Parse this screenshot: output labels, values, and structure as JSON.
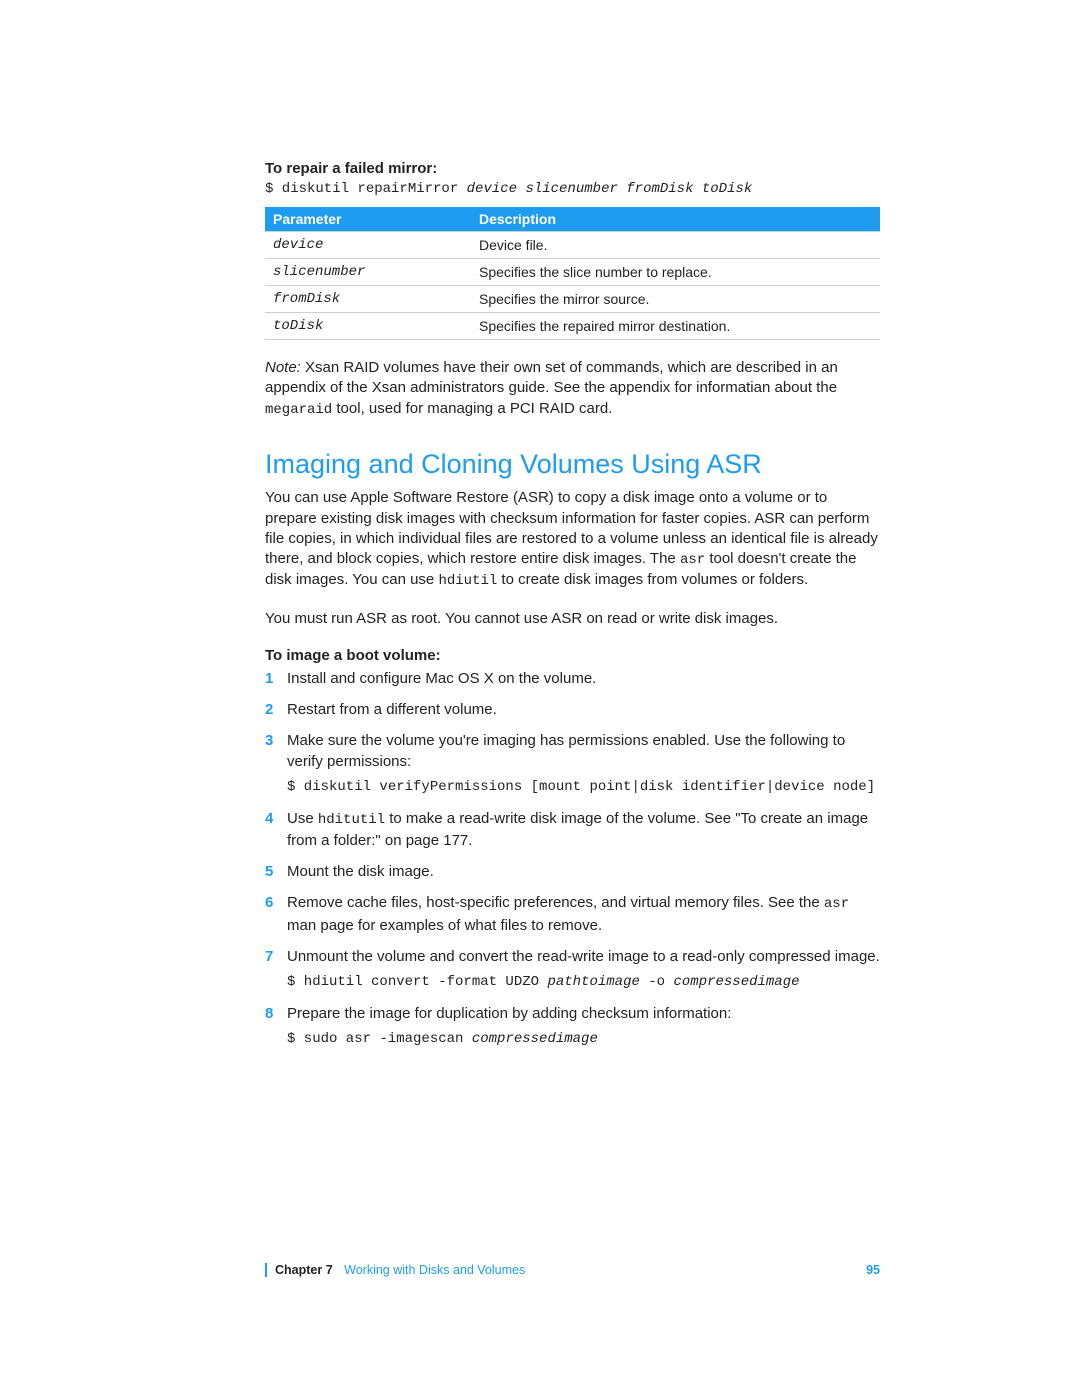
{
  "section1": {
    "heading": "To repair a failed mirror:",
    "cmd_prefix": "$ diskutil repairMirror ",
    "cmd_args": "device slicenumber fromDisk toDisk"
  },
  "table": {
    "head_param": "Parameter",
    "head_desc": "Description",
    "rows": [
      {
        "p": "device",
        "d": "Device file."
      },
      {
        "p": "slicenumber",
        "d": "Specifies the slice number to replace."
      },
      {
        "p": "fromDisk",
        "d": "Specifies the mirror source."
      },
      {
        "p": "toDisk",
        "d": "Specifies the repaired mirror destination."
      }
    ]
  },
  "note": {
    "label": "Note:  ",
    "text_a": "Xsan RAID volumes have their own set of commands, which are described in an appendix of the Xsan administrators guide. See the appendix for informatian about the ",
    "tool": "megaraid",
    "text_b": " tool, used for managing a PCI RAID card."
  },
  "h2": "Imaging and Cloning Volumes Using ASR",
  "intro": {
    "text_a": "You can use Apple Software Restore (ASR) to copy a disk image onto a volume or to prepare existing disk images with checksum information for faster copies. ASR can perform file copies, in which individual files are restored to a volume unless an identical file is already there, and block copies, which restore entire disk images. The ",
    "asr": "asr",
    "text_b": " tool doesn't create the disk images. You can use ",
    "hdi": "hdiutil",
    "text_c": " to create disk images from volumes or folders."
  },
  "root_line": "You must run ASR as root. You cannot use ASR on read or write disk images.",
  "steps_heading": "To image a boot volume:",
  "steps": {
    "s1": "Install and configure Mac OS X on the volume.",
    "s2": "Restart from a different volume.",
    "s3": "Make sure the volume you're imaging has permissions enabled. Use the following to verify permissions:",
    "s3_cmd": "$ diskutil verifyPermissions [mount point|disk identifier|device node]",
    "s4_a": "Use ",
    "s4_tool": "hditutil",
    "s4_b": " to make a read-write disk image of the volume. See \"To create an image from a folder:\" on page 177.",
    "s5": "Mount the disk image.",
    "s6_a": "Remove cache files, host-specific preferences, and virtual memory files. See the ",
    "s6_tool": "asr",
    "s6_b": " man page for examples of what files to remove.",
    "s7": "Unmount the volume and convert the read-write image to a read-only compressed image.",
    "s7_cmd_a": "$ hdiutil convert -format UDZO ",
    "s7_arg1": "pathtoimage",
    "s7_cmd_b": " -o ",
    "s7_arg2": "compressedimage",
    "s8": "Prepare the image for duplication by adding checksum information:",
    "s8_cmd_a": "$ sudo asr -imagescan ",
    "s8_arg": "compressedimage"
  },
  "footer": {
    "chapter": "Chapter 7",
    "title": "Working with Disks and Volumes",
    "page": "95"
  }
}
